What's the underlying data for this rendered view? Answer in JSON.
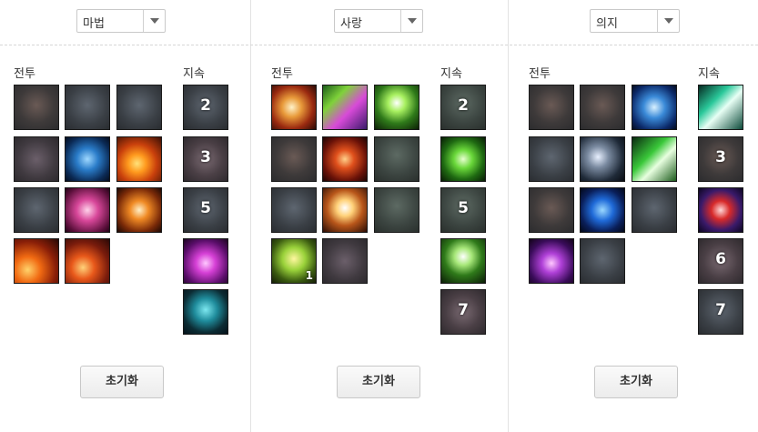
{
  "panels": [
    {
      "dropdown_label": "마법",
      "combat_label": "전투",
      "persist_label": "지속",
      "reset_label": "초기화",
      "combat_icons": [
        {
          "name": "fire-burst-icon",
          "style": "dim-a"
        },
        {
          "name": "spear-icon",
          "style": "dim-b"
        },
        {
          "name": "wind-slash-icon",
          "style": "dim-b"
        },
        {
          "name": "lightning-icon",
          "style": "dim-c"
        },
        {
          "name": "ice-foot-icon",
          "style": "ic-foot"
        },
        {
          "name": "flame-wave-icon",
          "style": "ic-fire"
        },
        {
          "name": "shoe-icon",
          "style": "dim-b"
        },
        {
          "name": "magic-scroll-icon",
          "style": "ic-scroll"
        },
        {
          "name": "fire-bolt-icon",
          "style": "ic-bolt"
        },
        {
          "name": "inferno-icon",
          "style": "ic-fire2"
        },
        {
          "name": "meteor-icon",
          "style": "ic-meteor"
        }
      ],
      "persist_icons": [
        {
          "name": "persist-rank-2-icon",
          "style": "dim-b",
          "number": "2"
        },
        {
          "name": "persist-rank-3-icon",
          "style": "dim-e",
          "number": "3"
        },
        {
          "name": "persist-rank-5-icon",
          "style": "dim-b",
          "number": "5"
        },
        {
          "name": "arcane-cast-icon",
          "style": "ic-magenta",
          "number": ""
        },
        {
          "name": "hooded-figure-icon",
          "style": "ic-hood",
          "number": ""
        }
      ]
    },
    {
      "dropdown_label": "사랑",
      "combat_label": "전투",
      "persist_label": "지속",
      "reset_label": "초기화",
      "combat_icons": [
        {
          "name": "healing-hand-icon",
          "style": "ic-hand"
        },
        {
          "name": "aurora-icon",
          "style": "ic-aurora"
        },
        {
          "name": "silhouette-light-icon",
          "style": "ic-silh"
        },
        {
          "name": "cross-icon",
          "style": "dim-a"
        },
        {
          "name": "claw-strike-icon",
          "style": "ic-claw"
        },
        {
          "name": "spirit-hands-icon",
          "style": "dim-d"
        },
        {
          "name": "reaching-hands-icon",
          "style": "dim-b"
        },
        {
          "name": "holy-cross-icon",
          "style": "ic-cross"
        },
        {
          "name": "stone-icon",
          "style": "dim-d"
        },
        {
          "name": "plus-heal-icon",
          "style": "ic-plus",
          "badge": "1"
        },
        {
          "name": "group-icon",
          "style": "dim-c"
        }
      ],
      "persist_icons": [
        {
          "name": "persist-rank-2-icon",
          "style": "dim-d",
          "number": "2"
        },
        {
          "name": "green-hand-icon",
          "style": "ic-greenhand",
          "number": ""
        },
        {
          "name": "persist-rank-5-icon",
          "style": "dim-d",
          "number": "5"
        },
        {
          "name": "heart-hands-icon",
          "style": "ic-heart",
          "number": ""
        },
        {
          "name": "persist-rank-7-icon",
          "style": "dim-e",
          "number": "7"
        }
      ]
    },
    {
      "dropdown_label": "의지",
      "combat_label": "전투",
      "persist_label": "지속",
      "reset_label": "초기화",
      "combat_icons": [
        {
          "name": "flex-figure-icon",
          "style": "dim-a"
        },
        {
          "name": "rough-stone-icon",
          "style": "dim-a"
        },
        {
          "name": "holy-shield-icon",
          "style": "ic-shield"
        },
        {
          "name": "radiance-icon",
          "style": "dim-b"
        },
        {
          "name": "meditating-man-icon",
          "style": "ic-man"
        },
        {
          "name": "green-ray-icon",
          "style": "ic-greenray"
        },
        {
          "name": "seated-figure-icon",
          "style": "dim-a"
        },
        {
          "name": "blue-head-icon",
          "style": "ic-head"
        },
        {
          "name": "blades-icon",
          "style": "dim-b"
        },
        {
          "name": "purple-hand-icon",
          "style": "ic-purplehand"
        },
        {
          "name": "swirl-icon",
          "style": "dim-b"
        }
      ],
      "persist_icons": [
        {
          "name": "green-sword-icon",
          "style": "ic-sword",
          "number": ""
        },
        {
          "name": "persist-rank-3-icon",
          "style": "dim-a",
          "number": "3"
        },
        {
          "name": "potion-bottle-icon",
          "style": "ic-bottle",
          "number": ""
        },
        {
          "name": "persist-rank-6-icon",
          "style": "dim-e",
          "number": "6"
        },
        {
          "name": "persist-rank-7-icon",
          "style": "dim-b",
          "number": "7"
        }
      ]
    }
  ]
}
